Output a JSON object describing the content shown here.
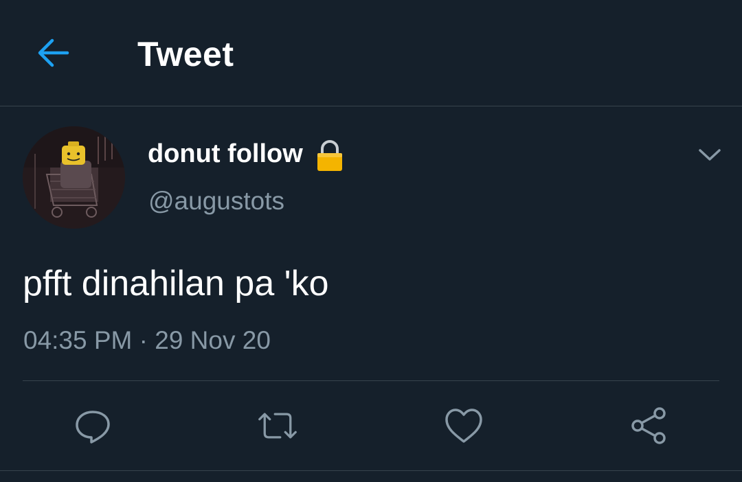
{
  "header": {
    "title": "Tweet",
    "back_icon": "back-arrow-icon"
  },
  "author": {
    "display_name": "donut follow",
    "username": "@augustots",
    "protected_icon": "lock-icon",
    "menu_icon": "chevron-down-icon"
  },
  "tweet": {
    "text": "pfft dinahilan pa 'ko",
    "timestamp": "04:35 PM · 29 Nov 20"
  },
  "actions": [
    {
      "name": "reply",
      "icon": "reply-icon"
    },
    {
      "name": "retweet",
      "icon": "retweet-icon"
    },
    {
      "name": "like",
      "icon": "heart-icon"
    },
    {
      "name": "share",
      "icon": "share-icon"
    }
  ],
  "colors": {
    "background": "#15202b",
    "divider": "#38444d",
    "accent": "#1da1f2",
    "secondary_text": "#8899a6",
    "lock": "#f4b400"
  }
}
